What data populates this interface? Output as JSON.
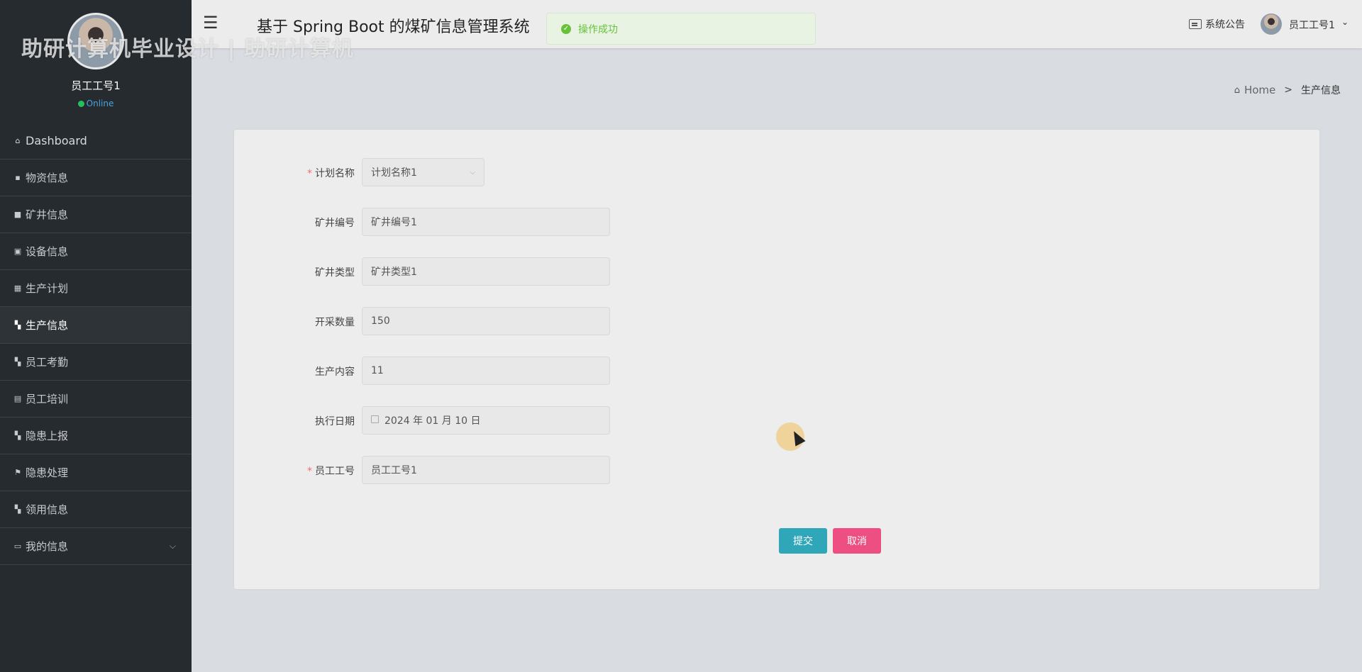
{
  "watermark": "助研计算机毕业设计 | 助研计算机",
  "sidebar": {
    "user_name": "员工工号1",
    "status": "Online",
    "items": [
      {
        "label": "Dashboard",
        "icon": "home-icon"
      },
      {
        "label": "物资信息",
        "icon": "comment-icon"
      },
      {
        "label": "矿井信息",
        "icon": "lock-icon"
      },
      {
        "label": "设备信息",
        "icon": "chart-icon"
      },
      {
        "label": "生产计划",
        "icon": "calendar-icon"
      },
      {
        "label": "生产信息",
        "icon": "grid-icon"
      },
      {
        "label": "员工考勤",
        "icon": "grid-icon"
      },
      {
        "label": "员工培训",
        "icon": "document-icon"
      },
      {
        "label": "隐患上报",
        "icon": "grid-icon"
      },
      {
        "label": "隐患处理",
        "icon": "flag-icon"
      },
      {
        "label": "领用信息",
        "icon": "grid-icon"
      },
      {
        "label": "我的信息",
        "icon": "card-icon",
        "chevron": "⌵"
      }
    ],
    "active_index": 5
  },
  "header": {
    "menu_icon": "☰",
    "title": "基于 Spring Boot 的煤矿信息管理系统",
    "toast": "操作成功",
    "notice": "系统公告",
    "user": "员工工号1",
    "user_chevron": "⌄"
  },
  "breadcrumb": {
    "home": "Home",
    "separator": ">",
    "current": "生产信息"
  },
  "form": {
    "plan_name": {
      "label": "计划名称",
      "value": "计划名称1",
      "required": true
    },
    "mine_number": {
      "label": "矿井编号",
      "value": "矿井编号1"
    },
    "mine_type": {
      "label": "矿井类型",
      "value": "矿井类型1"
    },
    "mining_quantity": {
      "label": "开采数量",
      "value": "150"
    },
    "production_content": {
      "label": "生产内容",
      "value": "11"
    },
    "execution_date": {
      "label": "执行日期",
      "value": "2024 年 01 月 10 日"
    },
    "employee_id": {
      "label": "员工工号",
      "value": "员工工号1",
      "required": true
    },
    "submit_label": "提交",
    "cancel_label": "取消"
  },
  "colors": {
    "sidebar_bg": "#262b2f",
    "submit": "#30a7b9",
    "cancel": "#ee4f82",
    "success": "#67c23a"
  }
}
